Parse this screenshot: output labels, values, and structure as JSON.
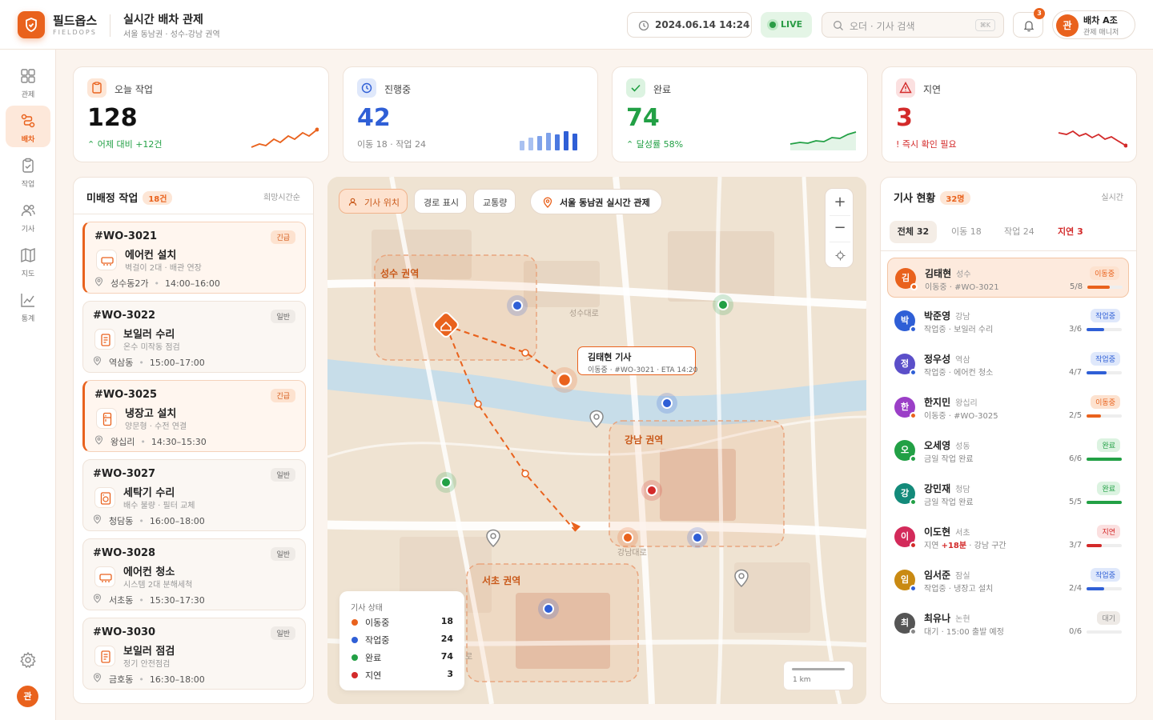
{
  "app": {
    "name": "필드옵스",
    "sub": "FIELDOPS",
    "title": "실시간 배차 관제",
    "subtitle": "서울 동남권 · 성수-강남 권역"
  },
  "header": {
    "datetime": "2024.06.14 14:24",
    "live": "LIVE",
    "search_placeholder": "오더 · 기사 검색",
    "shortcut": "⌘K",
    "notif_count": "3",
    "user_initial": "관",
    "user_name": "배차 A조",
    "user_role": "관제 매니저"
  },
  "sidebar": {
    "items": [
      {
        "label": "관제",
        "icon": "grid-icon"
      },
      {
        "label": "배차",
        "icon": "route-icon",
        "active": true
      },
      {
        "label": "작업",
        "icon": "clipboard-icon"
      },
      {
        "label": "기사",
        "icon": "users-icon"
      },
      {
        "label": "지도",
        "icon": "map-icon"
      },
      {
        "label": "통계",
        "icon": "chart-icon"
      }
    ],
    "avatar": "관"
  },
  "stats": [
    {
      "label": "오늘 작업",
      "value": "128",
      "note": "어제 대비 +12건",
      "color": "#e9621d"
    },
    {
      "label": "진행중",
      "value": "42",
      "note": "이동 18 · 작업 24",
      "color": "#2f5fd6"
    },
    {
      "label": "완료",
      "value": "74",
      "note": "달성률 58%",
      "color": "#22a045"
    },
    {
      "label": "지연",
      "value": "3",
      "note": "즉시 확인 필요",
      "color": "#d32a2a"
    }
  ],
  "unassigned": {
    "title": "미배정 작업",
    "count": "18건",
    "sort": "희망시간순",
    "jobs": [
      {
        "id": "#WO-3021",
        "tag": "긴급",
        "urgent": true,
        "title": "에어컨 설치",
        "desc": "벽걸이 2대 · 배관 연장",
        "loc": "성수동2가",
        "time": "14:00–16:00",
        "icon": "aircon-icon"
      },
      {
        "id": "#WO-3022",
        "tag": "일반",
        "urgent": false,
        "title": "보일러 수리",
        "desc": "온수 미작동 점검",
        "loc": "역삼동",
        "time": "15:00–17:00",
        "icon": "boiler-icon"
      },
      {
        "id": "#WO-3025",
        "tag": "긴급",
        "urgent": true,
        "title": "냉장고 설치",
        "desc": "양문형 · 수전 연결",
        "loc": "왕십리",
        "time": "14:30–15:30",
        "icon": "fridge-icon"
      },
      {
        "id": "#WO-3027",
        "tag": "일반",
        "urgent": false,
        "title": "세탁기 수리",
        "desc": "배수 불량 · 필터 교체",
        "loc": "청담동",
        "time": "16:00–18:00",
        "icon": "washer-icon"
      },
      {
        "id": "#WO-3028",
        "tag": "일반",
        "urgent": false,
        "title": "에어컨 청소",
        "desc": "시스템 2대 분해세척",
        "loc": "서초동",
        "time": "15:30–17:30",
        "icon": "aircon-icon"
      },
      {
        "id": "#WO-3030",
        "tag": "일반",
        "urgent": false,
        "title": "보일러 점검",
        "desc": "정기 안전점검",
        "loc": "금호동",
        "time": "16:30–18:00",
        "icon": "boiler-icon"
      }
    ]
  },
  "map": {
    "buttons": [
      "기사 위치",
      "경로 표시",
      "교통량"
    ],
    "region_label": "서울 동남권 실시간 관제",
    "zones": [
      "성수 권역",
      "강남 권역",
      "서초 권역"
    ],
    "roads": [
      "성수대로",
      "강남대로",
      "로"
    ],
    "callout": {
      "name": "김태현 기사",
      "detail": "이동중 · #WO-3021 · ETA 14:20"
    },
    "legend": {
      "title": "기사 상태",
      "items": [
        {
          "label": "이동중",
          "count": "18",
          "color": "#e9621d"
        },
        {
          "label": "작업중",
          "count": "24",
          "color": "#2f5fd6"
        },
        {
          "label": "완료",
          "count": "74",
          "color": "#22a045"
        },
        {
          "label": "지연",
          "count": "3",
          "color": "#d32a2a"
        }
      ]
    },
    "scale": "1 km"
  },
  "drivers": {
    "title": "기사 현황",
    "count": "32명",
    "realtime": "실시간",
    "tabs": [
      "전체 32",
      "이동 18",
      "작업 24",
      "지연 3"
    ],
    "list": [
      {
        "initial": "김",
        "name": "김태현",
        "area": "성수",
        "status": "이동중 · #WO-3021",
        "badge": "이동중",
        "progress": "5/8",
        "ratio": 0.625,
        "color": "#e9621d",
        "bg": "#fde2cf",
        "avatar": "#e9621d"
      },
      {
        "initial": "박",
        "name": "박준영",
        "area": "강남",
        "status": "작업중 · 보일러 수리",
        "badge": "작업중",
        "progress": "3/6",
        "ratio": 0.5,
        "color": "#2f5fd6",
        "bg": "#dfe8fb",
        "avatar": "#2f5fd6"
      },
      {
        "initial": "정",
        "name": "정우성",
        "area": "역삼",
        "status": "작업중 · 에어컨 청소",
        "badge": "작업중",
        "progress": "4/7",
        "ratio": 0.57,
        "color": "#2f5fd6",
        "bg": "#dfe8fb",
        "avatar": "#5b4fc9"
      },
      {
        "initial": "한",
        "name": "한지민",
        "area": "왕십리",
        "status": "이동중 · #WO-3025",
        "badge": "이동중",
        "progress": "2/5",
        "ratio": 0.4,
        "color": "#e9621d",
        "bg": "#fde2cf",
        "avatar": "#9b3fc7"
      },
      {
        "initial": "오",
        "name": "오세영",
        "area": "성동",
        "status": "금일 작업 완료",
        "badge": "완료",
        "progress": "6/6",
        "ratio": 1,
        "color": "#22a045",
        "bg": "#dcf3e1",
        "avatar": "#22a045"
      },
      {
        "initial": "강",
        "name": "강민재",
        "area": "청담",
        "status": "금일 작업 완료",
        "badge": "완료",
        "progress": "5/5",
        "ratio": 1,
        "color": "#22a045",
        "bg": "#dcf3e1",
        "avatar": "#138a7a"
      },
      {
        "initial": "이",
        "name": "이도현",
        "area": "서초",
        "status_pre": "지연 ",
        "status_delay": "+18분",
        "status_post": " · 강남 구간",
        "badge": "지연",
        "progress": "3/7",
        "ratio": 0.43,
        "color": "#d32a2a",
        "bg": "#fbe0e0",
        "avatar": "#d32a5a"
      },
      {
        "initial": "임",
        "name": "임서준",
        "area": "잠실",
        "status": "작업중 · 냉장고 설치",
        "badge": "작업중",
        "progress": "2/4",
        "ratio": 0.5,
        "color": "#2f5fd6",
        "bg": "#dfe8fb",
        "avatar": "#c98a12"
      },
      {
        "initial": "최",
        "name": "최유나",
        "area": "논현",
        "status": "대기 · 15:00 출발 예정",
        "badge": "대기",
        "progress": "0/6",
        "ratio": 0,
        "color": "#888",
        "bg": "#eeeae6",
        "avatar": "#555"
      }
    ]
  }
}
